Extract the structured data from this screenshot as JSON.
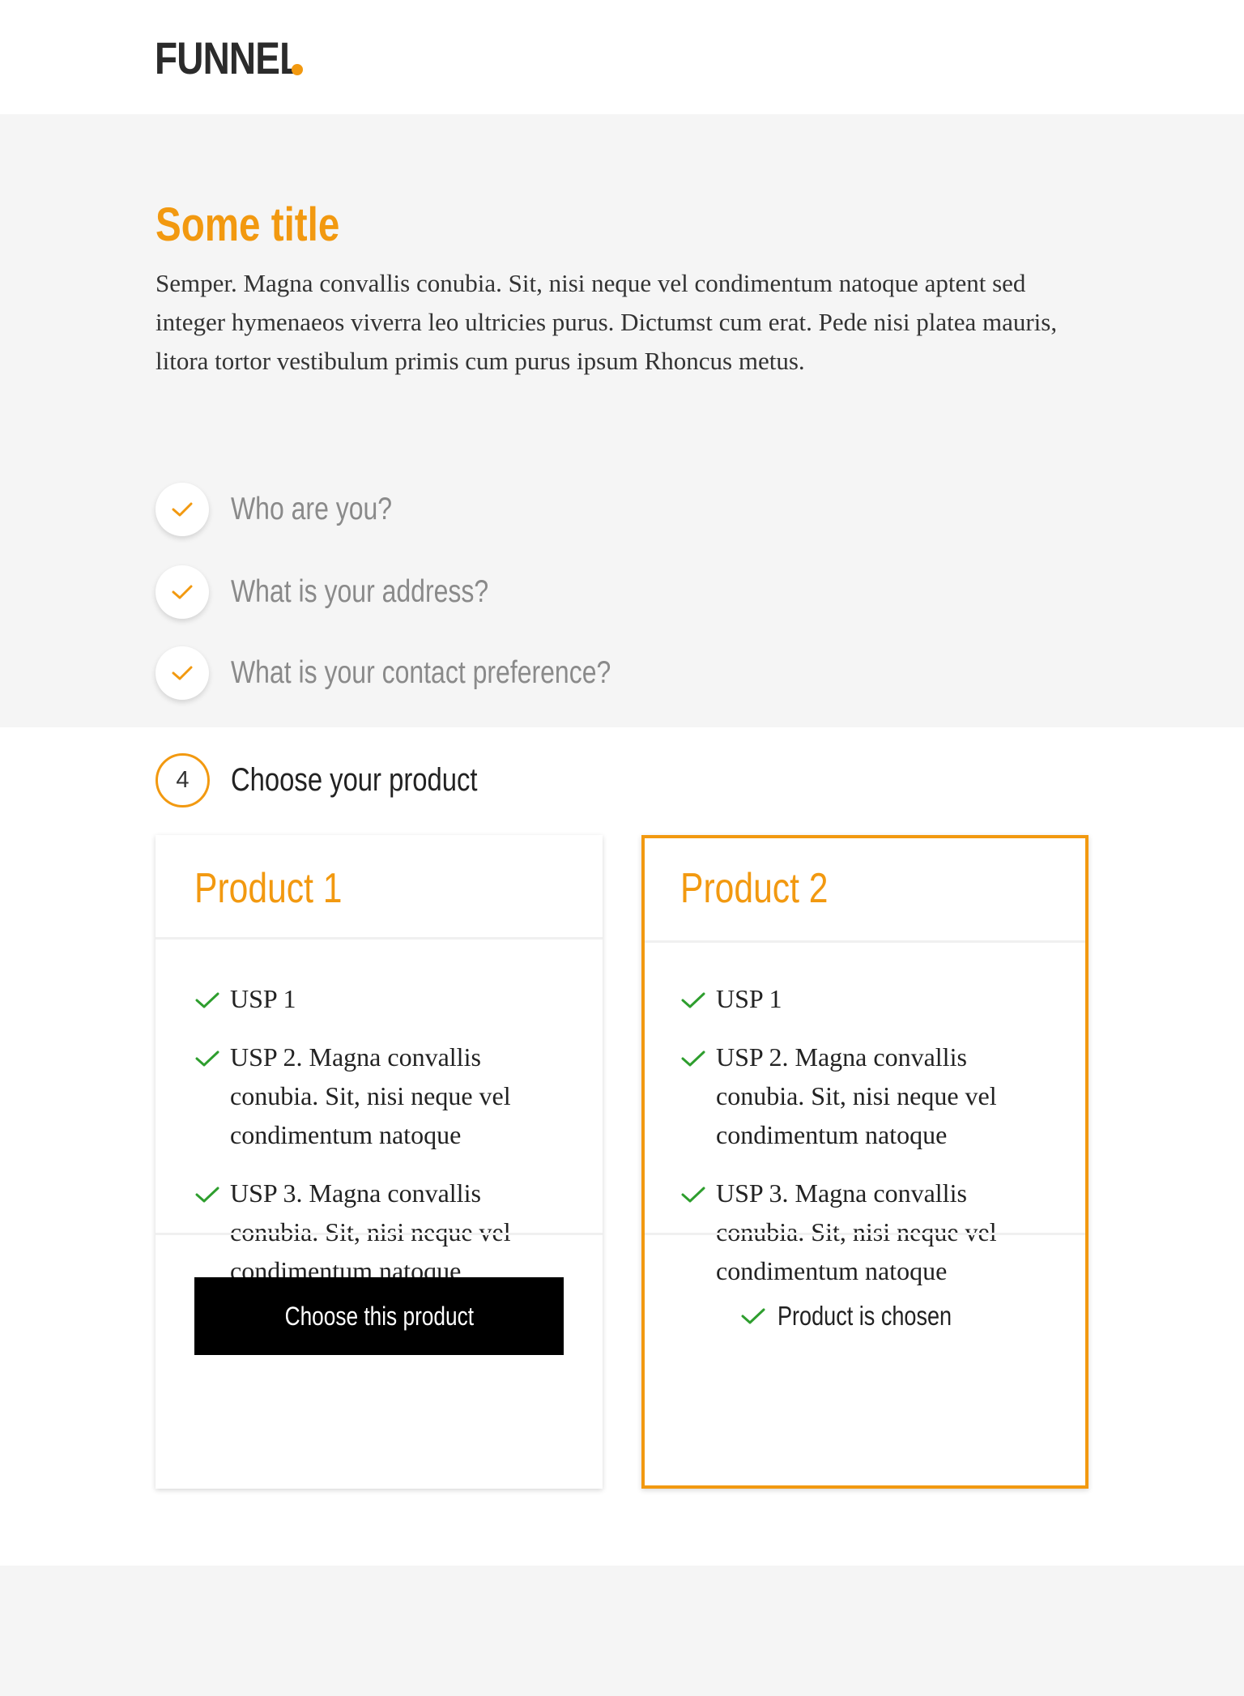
{
  "brand": {
    "logo_text": "FUNNEL",
    "accent": "#f29910"
  },
  "intro": {
    "title": "Some title",
    "text": "Semper. Magna convallis conubia. Sit, nisi neque vel condimentum natoque aptent sed integer hymenaeos viverra leo ultricies purus. Dictumst cum erat. Pede nisi platea mauris, litora tortor vestibulum primis cum purus ipsum Rhoncus metus."
  },
  "steps": [
    {
      "label": "Who are you?",
      "status": "completed",
      "icon": "check-icon"
    },
    {
      "label": "What is your address?",
      "status": "completed",
      "icon": "check-icon"
    },
    {
      "label": "What is your contact preference?",
      "status": "completed",
      "icon": "check-icon"
    }
  ],
  "current_step": {
    "number": "4",
    "label": "Choose your product"
  },
  "products": [
    {
      "name": "Product 1",
      "usps": [
        "USP 1",
        "USP 2. Magna convallis conubia. Sit, nisi neque vel condimentum natoque",
        "USP 3. Magna convallis conubia. Sit, nisi neque vel condimentum natoque"
      ],
      "selected": false,
      "button_label": "Choose this product"
    },
    {
      "name": "Product 2",
      "usps": [
        "USP 1",
        "USP 2. Magna convallis conubia. Sit, nisi neque vel condimentum natoque",
        "USP 3. Magna convallis conubia. Sit, nisi neque vel condimentum natoque"
      ],
      "selected": true,
      "chosen_label": "Product is chosen"
    }
  ],
  "colors": {
    "accent": "#f29910",
    "check_green": "#2e9e2e",
    "band": "#f5f5f5",
    "button": "#000000"
  }
}
